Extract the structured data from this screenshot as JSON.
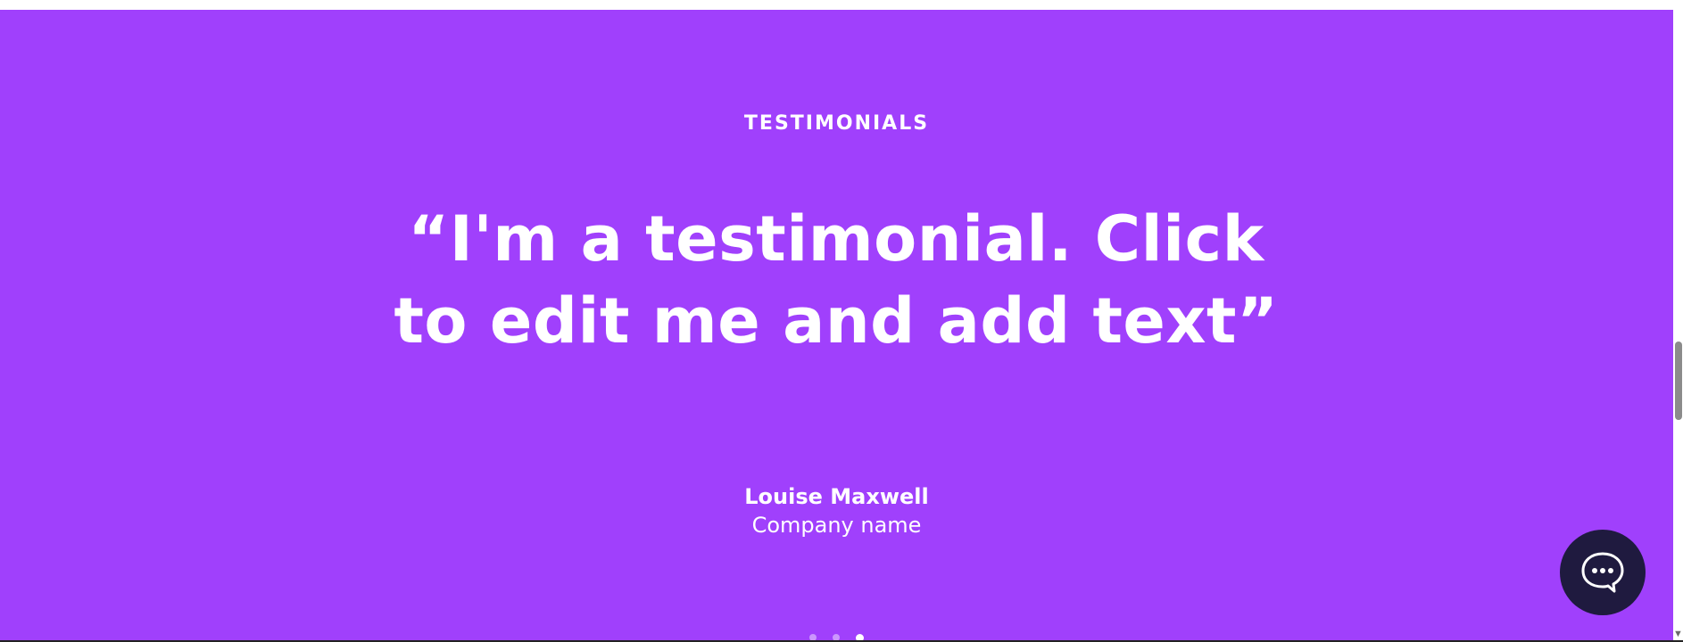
{
  "testimonials": {
    "eyebrow": "TESTIMONIALS",
    "quote": "“I'm a testimonial. Click to edit me and add text”",
    "author_name": "Louise Maxwell",
    "company": "Company name",
    "pagination": {
      "count": 3,
      "active_index": 2
    }
  },
  "colors": {
    "section_background": "#a040fc",
    "text": "#ffffff",
    "chat_button_background": "#1f1a3f"
  },
  "icons": {
    "chat": "chat-bubble-icon",
    "scroll_down": "scroll-down-arrow-icon"
  }
}
